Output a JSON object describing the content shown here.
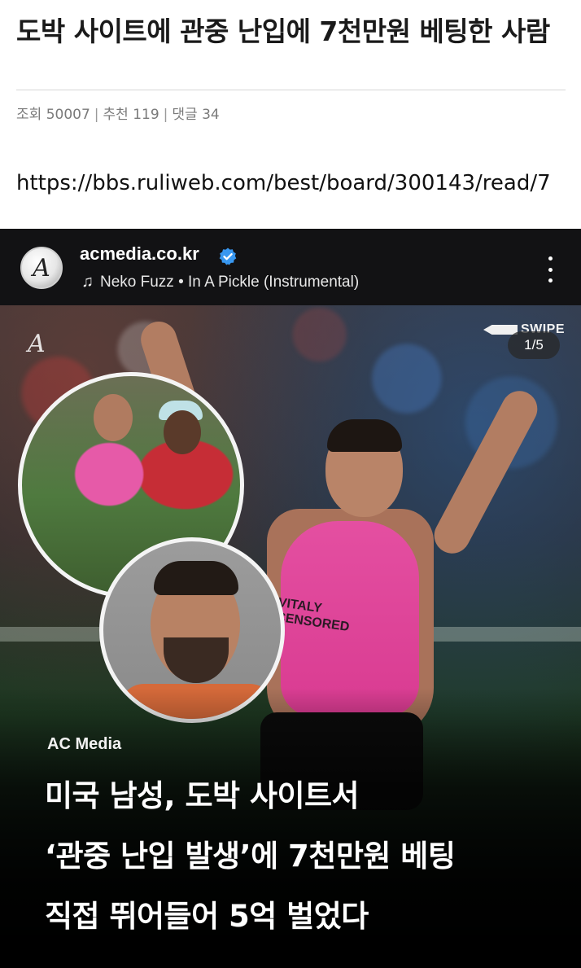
{
  "post": {
    "title": "도박 사이트에 관중 난입에 7천만원 베팅한 사람",
    "meta": {
      "views_label": "조회",
      "views": "50007",
      "likes_label": "추천",
      "likes": "119",
      "comments_label": "댓글",
      "comments": "34"
    },
    "source_link": "https://bbs.ruliweb.com/best/board/300143/read/7"
  },
  "embed": {
    "account": "acmedia.co.kr",
    "avatar_letter": "A",
    "music": "Neko Fuzz • In A Pickle (Instrumental)",
    "swipe_label": "SWIPE",
    "page_counter": "1/5",
    "watermark": "A",
    "singlet_text": "VITALY CENSORED",
    "brand_tag": "AC Media",
    "headline": [
      "미국 남성, 도박 사이트서",
      "‘관중 난입 발생’에 7천만원 베팅",
      "직접 뛰어들어 5억 벌었다"
    ],
    "icons": {
      "verified": "verified-badge-icon",
      "music": "music-note-icon",
      "more": "more-vertical-icon"
    },
    "colors": {
      "verified_blue": "#3897f0",
      "singlet_pink": "#e44fa1"
    }
  }
}
